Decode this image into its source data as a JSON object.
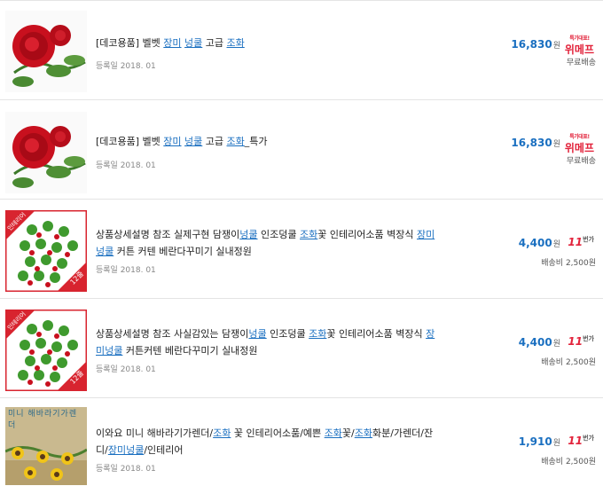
{
  "items": [
    {
      "title_parts": [
        {
          "t": "[데코용품] 벨벳 ",
          "kw": false
        },
        {
          "t": "장미",
          "kw": true
        },
        {
          "t": " ",
          "kw": false
        },
        {
          "t": "넝쿨",
          "kw": true
        },
        {
          "t": " 고급 ",
          "kw": false
        },
        {
          "t": "조화",
          "kw": true
        }
      ],
      "date": "등록일 2018. 01",
      "price": "16,830",
      "won": "원",
      "mall": "위메프",
      "mall_top": "특가대표!",
      "shipping": "무료배송"
    },
    {
      "title_parts": [
        {
          "t": "[데코용품] 벨벳 ",
          "kw": false
        },
        {
          "t": "장미",
          "kw": true
        },
        {
          "t": " ",
          "kw": false
        },
        {
          "t": "넝쿨",
          "kw": true
        },
        {
          "t": " 고급 ",
          "kw": false
        },
        {
          "t": "조화",
          "kw": true
        },
        {
          "t": "_특가",
          "kw": false
        }
      ],
      "date": "등록일 2018. 01",
      "price": "16,830",
      "won": "원",
      "mall": "위메프",
      "mall_top": "특가대표!",
      "shipping": "무료배송"
    },
    {
      "title_parts": [
        {
          "t": "상품상세설명 참조 실제구현 담쟁이",
          "kw": false
        },
        {
          "t": "넝쿨",
          "kw": true
        },
        {
          "t": " 인조덩쿨 ",
          "kw": false
        },
        {
          "t": "조화",
          "kw": true
        },
        {
          "t": "꽃 인테리어소품 벽장식 ",
          "kw": false
        },
        {
          "t": "장미넝쿨",
          "kw": true
        },
        {
          "t": " 커튼 커텐 베란다꾸미기 실내정원",
          "kw": false
        }
      ],
      "date": "등록일 2018. 01",
      "price": "4,400",
      "won": "원",
      "mall": "11",
      "mall_sub": "번가",
      "shipping": "배송비 2,500원"
    },
    {
      "title_parts": [
        {
          "t": "상품상세설명 참조 사실감있는 담쟁이",
          "kw": false
        },
        {
          "t": "넝쿨",
          "kw": true
        },
        {
          "t": " 인조덩쿨 ",
          "kw": false
        },
        {
          "t": "조화",
          "kw": true
        },
        {
          "t": "꽃 인테리어소품 벽장식 ",
          "kw": false
        },
        {
          "t": "장미넝쿨",
          "kw": true
        },
        {
          "t": " 커튼커텐 베란다꾸미기 실내정원",
          "kw": false
        }
      ],
      "date": "등록일 2018. 01",
      "price": "4,400",
      "won": "원",
      "mall": "11",
      "mall_sub": "번가",
      "shipping": "배송비 2,500원"
    },
    {
      "title_parts": [
        {
          "t": "이와요 미니 해바라기가렌더/",
          "kw": false
        },
        {
          "t": "조화",
          "kw": true
        },
        {
          "t": " 꽃 인테리어소품/예쁜 ",
          "kw": false
        },
        {
          "t": "조화",
          "kw": true
        },
        {
          "t": "꽃/",
          "kw": false
        },
        {
          "t": "조화",
          "kw": true
        },
        {
          "t": "화분/가렌더/잔디/",
          "kw": false
        },
        {
          "t": "장미넝쿨",
          "kw": true
        },
        {
          "t": "/인테리어",
          "kw": false
        }
      ],
      "date": "등록일 2018. 01",
      "price": "1,910",
      "won": "원",
      "mall": "11",
      "mall_sub": "번가",
      "shipping": "배송비 2,500원"
    }
  ],
  "thumbs": [
    {
      "kind": "rose"
    },
    {
      "kind": "rose"
    },
    {
      "kind": "ivy",
      "badge_top": "인테리어",
      "badge_bottom": "12줄"
    },
    {
      "kind": "ivy",
      "badge_top": "인테리어",
      "badge_bottom": "12줄"
    },
    {
      "kind": "sunflower",
      "text": "미니 해바라기가렌더"
    }
  ]
}
